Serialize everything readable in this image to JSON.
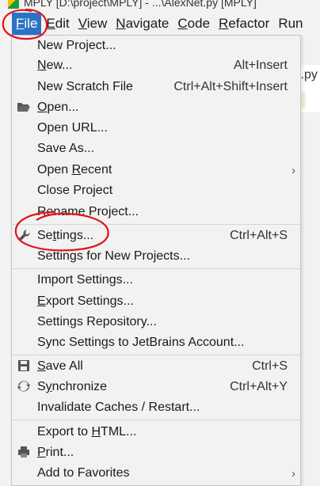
{
  "titlebar": {
    "text": "MPLY [D:\\project\\MPLY] - ...\\AlexNet.py [MPLY]"
  },
  "menubar": {
    "menus": [
      {
        "pre": "",
        "mn": "F",
        "post": "ile"
      },
      {
        "pre": "",
        "mn": "E",
        "post": "dit"
      },
      {
        "pre": "",
        "mn": "V",
        "post": "iew"
      },
      {
        "pre": "",
        "mn": "N",
        "post": "avigate"
      },
      {
        "pre": "",
        "mn": "C",
        "post": "ode"
      },
      {
        "pre": "",
        "mn": "R",
        "post": "efactor"
      },
      {
        "pre": "R",
        "mn": "",
        "post": "un"
      }
    ]
  },
  "editor": {
    "tab_text": "l.py"
  },
  "file_menu": {
    "items": [
      {
        "pre": "New Project...",
        "mn": "",
        "post": "",
        "shortcut": ""
      },
      {
        "pre": "",
        "mn": "N",
        "post": "ew...",
        "shortcut": "Alt+Insert"
      },
      {
        "pre": "New Scratch File",
        "mn": "",
        "post": "",
        "shortcut": "Ctrl+Alt+Shift+Insert"
      },
      {
        "pre": "",
        "mn": "O",
        "post": "pen...",
        "shortcut": "",
        "icon": "folder-icon"
      },
      {
        "pre": "Open URL...",
        "mn": "",
        "post": "",
        "shortcut": ""
      },
      {
        "pre": "Save As...",
        "mn": "",
        "post": "",
        "shortcut": ""
      },
      {
        "pre": "Open ",
        "mn": "R",
        "post": "ecent",
        "shortcut": "",
        "submenu": "›"
      },
      {
        "pre": "Close Project",
        "mn": "",
        "post": "",
        "shortcut": ""
      },
      {
        "pre": "Rename Project...",
        "mn": "",
        "post": "",
        "shortcut": ""
      },
      {
        "pre": "Se",
        "mn": "t",
        "post": "tings...",
        "shortcut": "Ctrl+Alt+S",
        "icon": "wrench-icon"
      },
      {
        "pre": "Settings for New Projects...",
        "mn": "",
        "post": "",
        "shortcut": ""
      },
      {
        "pre": "Import Settings...",
        "mn": "",
        "post": "",
        "shortcut": ""
      },
      {
        "pre": "",
        "mn": "E",
        "post": "xport Settings...",
        "shortcut": ""
      },
      {
        "pre": "Settings Repository...",
        "mn": "",
        "post": "",
        "shortcut": ""
      },
      {
        "pre": "Sync Settings to JetBrains Account...",
        "mn": "",
        "post": "",
        "shortcut": ""
      },
      {
        "pre": "",
        "mn": "S",
        "post": "ave All",
        "shortcut": "Ctrl+S",
        "icon": "save-icon"
      },
      {
        "pre": "S",
        "mn": "y",
        "post": "nchronize",
        "shortcut": "Ctrl+Alt+Y",
        "icon": "sync-icon"
      },
      {
        "pre": "Invalidate Caches / Restart...",
        "mn": "",
        "post": "",
        "shortcut": ""
      },
      {
        "pre": "Export to ",
        "mn": "H",
        "post": "TML...",
        "shortcut": ""
      },
      {
        "pre": "",
        "mn": "P",
        "post": "rint...",
        "shortcut": "",
        "icon": "printer-icon"
      },
      {
        "pre": "Add to Favorites",
        "mn": "",
        "post": "",
        "shortcut": "",
        "submenu": "›"
      }
    ]
  },
  "colors": {
    "menu_active": "#2d73c4",
    "annotation": "#e0141c"
  }
}
